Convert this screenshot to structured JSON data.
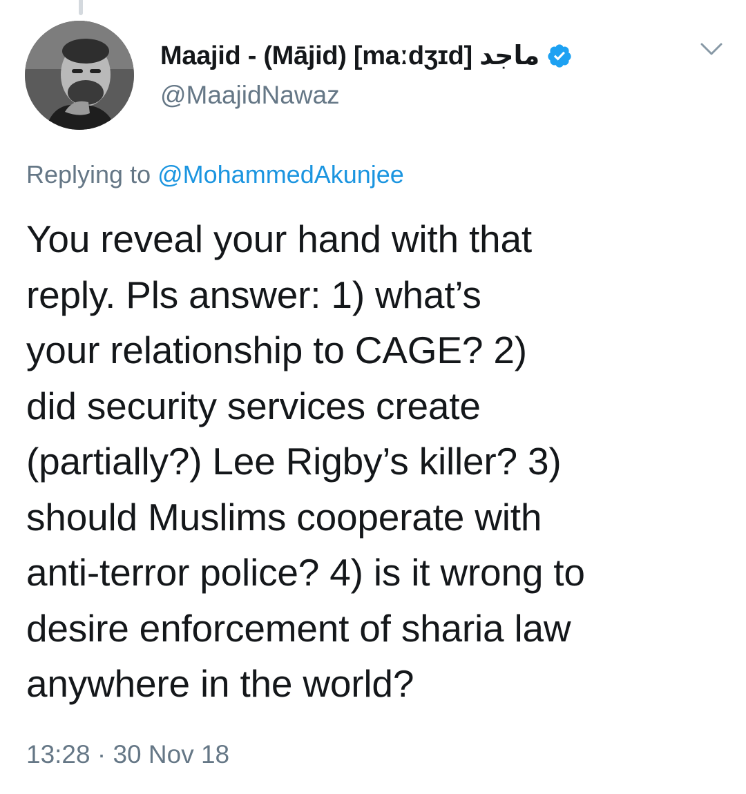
{
  "tweet": {
    "author": {
      "display_name": "Maajid - (Mājid) [maːdʒɪd] ماجد",
      "handle": "@MaajidNawaz",
      "verified": true
    },
    "replying_prefix": "Replying to ",
    "replying_to": "@MohammedAkunjee",
    "text_lines": [
      "You reveal your hand with that",
      "reply. Pls answer: 1) what’s",
      "your relationship to CAGE? 2)",
      "did security services create",
      "(partially?) Lee Rigby’s killer? 3)",
      "should Muslims cooperate with",
      "anti-terror police? 4) is it wrong to",
      "desire enforcement of sharia law",
      "anywhere in the world?"
    ],
    "timestamp": "13:28 · 30 Nov 18"
  },
  "icons": {
    "verified": "verified-badge-icon",
    "caret": "chevron-down-icon"
  },
  "colors": {
    "verified_blue": "#1da1f2",
    "link_blue": "#1b95e0",
    "secondary_text": "#657786",
    "primary_text": "#14171a"
  }
}
